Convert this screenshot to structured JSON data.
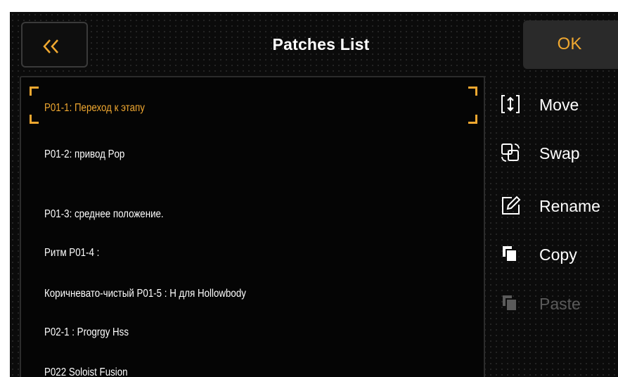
{
  "header": {
    "back_icon": "double-chevron-left-icon",
    "title": "Patches List",
    "ok_label": "OK"
  },
  "colors": {
    "accent": "#f0a830",
    "background": "#0b0b0b",
    "panel_border": "#2c2c2c",
    "disabled": "#5a5a5a"
  },
  "patches": [
    {
      "label": "P01-1: Переход к этапу",
      "selected": true
    },
    {
      "label": "P01-2: привод Pop"
    },
    {
      "label": "P01-3: среднее положение."
    },
    {
      "label": "Ритм P01-4 :"
    },
    {
      "label": "Коричневато-чистый P01-5 : H для Hollowbody"
    },
    {
      "label": "P02-1 : Progrgy Hss"
    },
    {
      "label": "P022 Soloist Fusion"
    }
  ],
  "actions": [
    {
      "label": "Move",
      "icon": "move-icon",
      "enabled": true
    },
    {
      "label": "Swap",
      "icon": "swap-icon",
      "enabled": true
    },
    {
      "label": "Rename",
      "icon": "rename-icon",
      "enabled": true
    },
    {
      "label": "Copy",
      "icon": "copy-icon",
      "enabled": true
    },
    {
      "label": "Paste",
      "icon": "paste-icon",
      "enabled": false
    }
  ]
}
